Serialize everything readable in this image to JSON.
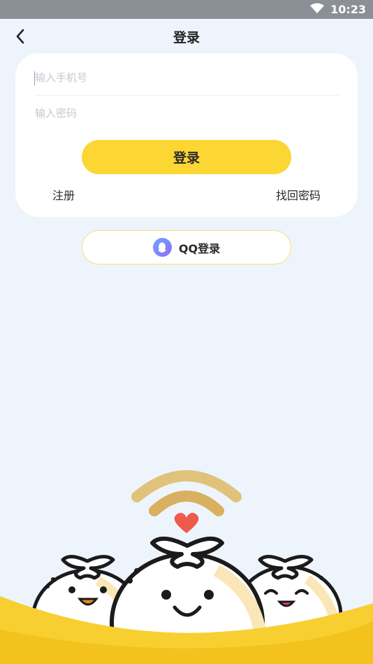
{
  "status_bar": {
    "time": "10:23"
  },
  "header": {
    "title": "登录"
  },
  "form": {
    "phone_placeholder": "输入手机号",
    "password_placeholder": "输入密码",
    "login_label": "登录",
    "register_label": "注册",
    "recover_label": "找回密码"
  },
  "qq_login": {
    "label": "QQ登录"
  },
  "colors": {
    "accent": "#fcd733",
    "background": "#eef4fc",
    "heart": "#f05a4a"
  }
}
